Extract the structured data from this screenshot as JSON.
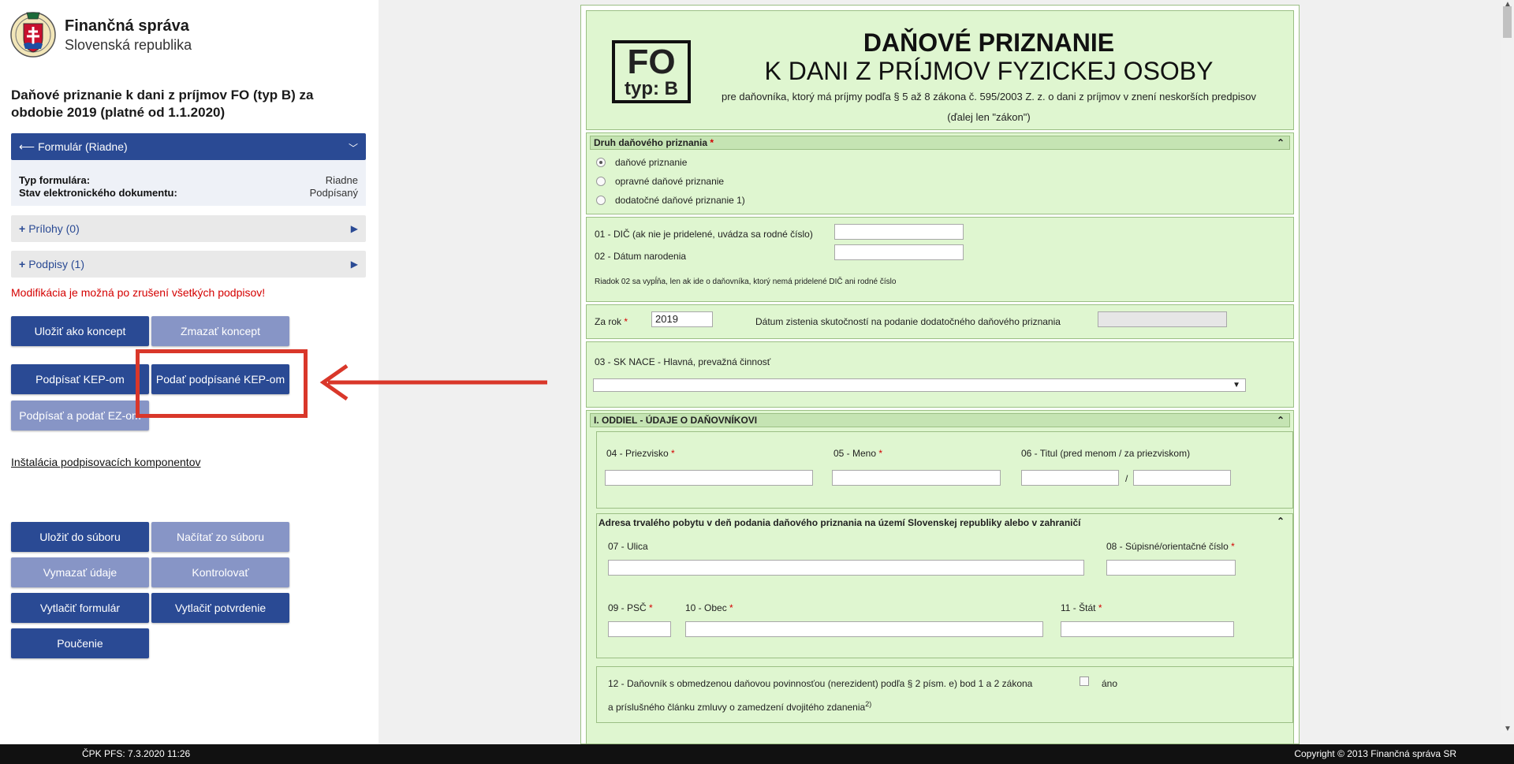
{
  "sidebar": {
    "org_name": "Finančná správa",
    "org_sub": "Slovenská republika",
    "doc_title": "Daňové priznanie k dani z príjmov FO (typ B) za obdobie 2019 (platné od 1.1.2020)",
    "form_panel": {
      "label": "Formulár (Riadne)",
      "rows": [
        {
          "key": "Typ formulára:",
          "value": "Riadne"
        },
        {
          "key": "Stav elektronického dokumentu:",
          "value": "Podpísaný"
        }
      ]
    },
    "attachments_label": "Prílohy (0)",
    "signatures_label": "Podpisy (1)",
    "warning": "Modifikácia je možná po zrušení všetkých podpisov!",
    "buttons": {
      "save_draft": "Uložiť ako koncept",
      "delete_draft": "Zmazať koncept",
      "sign_kep": "Podpísať KEP-om",
      "submit_signed_kep": "Podať podpísané KEP-om",
      "sign_submit_ez": "Podpísať a podať EZ-om",
      "save_file": "Uložiť do súboru",
      "load_file": "Načítať zo súboru",
      "clear_data": "Vymazať údaje",
      "check": "Kontrolovať",
      "print_form": "Vytlačiť formulár",
      "print_confirm": "Vytlačiť potvrdenie",
      "instructions": "Poučenie"
    },
    "install_link": "Inštalácia podpisovacích komponentov"
  },
  "form": {
    "badge_top": "FO",
    "badge_bottom": "typ: B",
    "title": "DAŇOVÉ PRIZNANIE",
    "subtitle": "K DANI Z PRÍJMOV FYZICKEJ OSOBY",
    "description": "pre daňovníka, ktorý má príjmy podľa § 5 až 8 zákona č. 595/2003 Z. z. o dani z príjmov v znení neskorších predpisov (ďalej len \"zákon\")",
    "type_section": {
      "title": "Druh daňového priznania",
      "options": [
        "daňové priznanie",
        "opravné daňové priznanie",
        "dodatočné daňové priznanie 1)"
      ],
      "selected": 0
    },
    "dic_label": "01 - DIČ (ak nie je pridelené, uvádza sa rodné číslo)",
    "birth_label": "02 - Dátum narodenia",
    "note_02": "Riadok 02 sa vypĺňa, len ak ide o daňovníka, ktorý nemá pridelené DIČ ani rodné číslo",
    "year_label": "Za rok",
    "year_value": "2019",
    "discovery_label": "Dátum zistenia skutočností na podanie dodatočného daňového priznania",
    "nace_label": "03 - SK NACE - Hlavná, prevažná činnosť",
    "section1_title": "I. ODDIEL - ÚDAJE O DAŇOVNÍKOVI",
    "surname_label": "04 - Priezvisko",
    "name_label": "05 - Meno",
    "title_label": "06 - Titul (pred menom / za priezviskom)",
    "slash": "/",
    "address_title": "Adresa trvalého pobytu v deň podania daňového priznania na území Slovenskej republiky alebo v zahraničí",
    "street_label": "07 - Ulica",
    "number_label": "08 - Súpisné/orientačné číslo",
    "psc_label": "09 - PSČ",
    "city_label": "10 - Obec",
    "state_label": "11 - Štát",
    "nonresident_label_1": "12 - Daňovník s obmedzenou daňovou povinnosťou (nerezident) podľa § 2 písm. e) bod 1 a 2 zákona",
    "nonresident_label_2": "a príslušného článku zmluvy o zamedzení dvojitého zdanenia",
    "nonresident_sup": "2)",
    "yes_label": "áno"
  },
  "footer": {
    "left": "ČPK PFS: 7.3.2020 11:26",
    "right": "Copyright © 2013 Finančná správa SR"
  },
  "colors": {
    "primary": "#2a4a94",
    "primary_light": "#8795c6",
    "form_bg": "#dff6d0",
    "annotation": "#d9372a"
  }
}
